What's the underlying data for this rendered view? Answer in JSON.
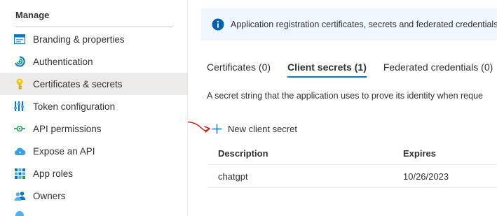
{
  "sidebar": {
    "section_title": "Manage",
    "items": [
      {
        "label": "Branding & properties",
        "icon": "branding-icon"
      },
      {
        "label": "Authentication",
        "icon": "authentication-icon"
      },
      {
        "label": "Certificates & secrets",
        "icon": "key-icon",
        "active": true
      },
      {
        "label": "Token configuration",
        "icon": "token-configuration-icon"
      },
      {
        "label": "API permissions",
        "icon": "api-permissions-icon"
      },
      {
        "label": "Expose an API",
        "icon": "cloud-icon"
      },
      {
        "label": "App roles",
        "icon": "app-roles-icon"
      },
      {
        "label": "Owners",
        "icon": "owners-icon"
      }
    ]
  },
  "banner": {
    "icon": "info-icon",
    "text": "Application registration certificates, secrets and federated credentials can"
  },
  "tabs": [
    {
      "label": "Certificates (0)"
    },
    {
      "label": "Client secrets (1)",
      "active": true
    },
    {
      "label": "Federated credentials (0)"
    }
  ],
  "description": "A secret string that the application uses to prove its identity when reque",
  "new_secret": {
    "label": "New client secret",
    "icon": "plus-icon"
  },
  "table": {
    "headers": [
      "Description",
      "Expires"
    ],
    "rows": [
      {
        "description": "chatgpt",
        "expires": "10/26/2023"
      }
    ]
  },
  "colors": {
    "accent": "#0078d4",
    "annotation": "#d11b1b",
    "banner_bg": "#f0f6ff",
    "active_nav_bg": "#edebe9"
  }
}
